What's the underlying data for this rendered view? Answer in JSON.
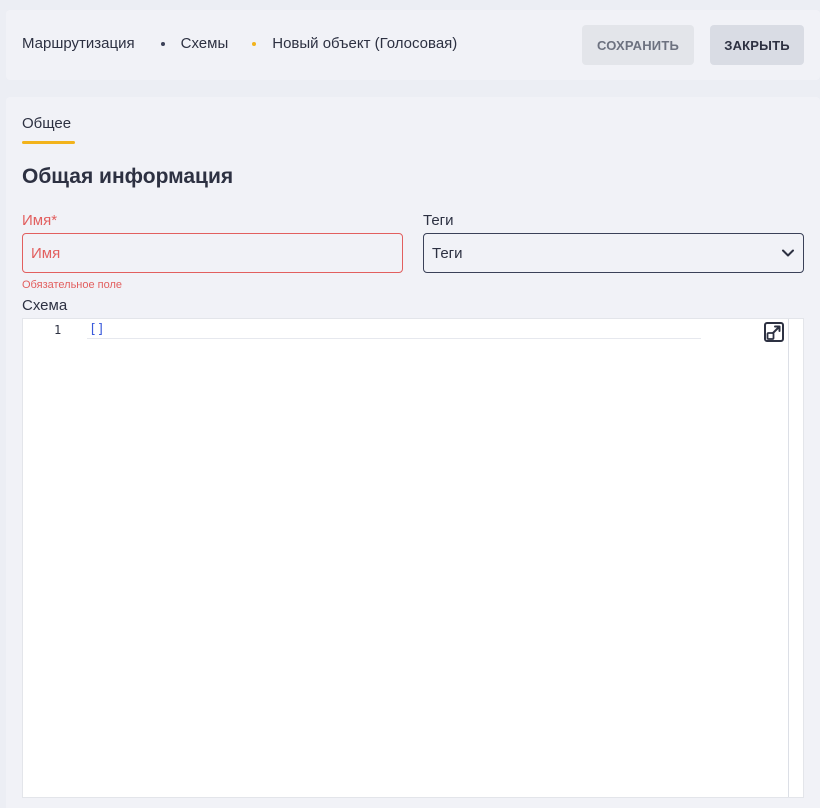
{
  "breadcrumb": {
    "items": [
      "Маршрутизация",
      "Схемы",
      "Новый объект (Голосовая)"
    ]
  },
  "toolbar": {
    "save_label": "СОХРАНИТЬ",
    "close_label": "ЗАКРЫТЬ"
  },
  "tabs": [
    {
      "label": "Общее",
      "active": true
    }
  ],
  "section": {
    "title": "Общая информация"
  },
  "form": {
    "name": {
      "label": "Имя*",
      "placeholder": "Имя",
      "value": "",
      "error": "Обязательное поле"
    },
    "tags": {
      "label": "Теги",
      "value": "Теги",
      "icon": "chevron-down-icon"
    },
    "schema": {
      "label": "Схема",
      "line_number": "1",
      "code": "[]",
      "expand_icon": "expand-icon"
    }
  },
  "colors": {
    "accent": "#f2b31b",
    "error": "#e25f5f",
    "background": "#f1f2f7",
    "code_bracket": "#3b5bdb"
  }
}
